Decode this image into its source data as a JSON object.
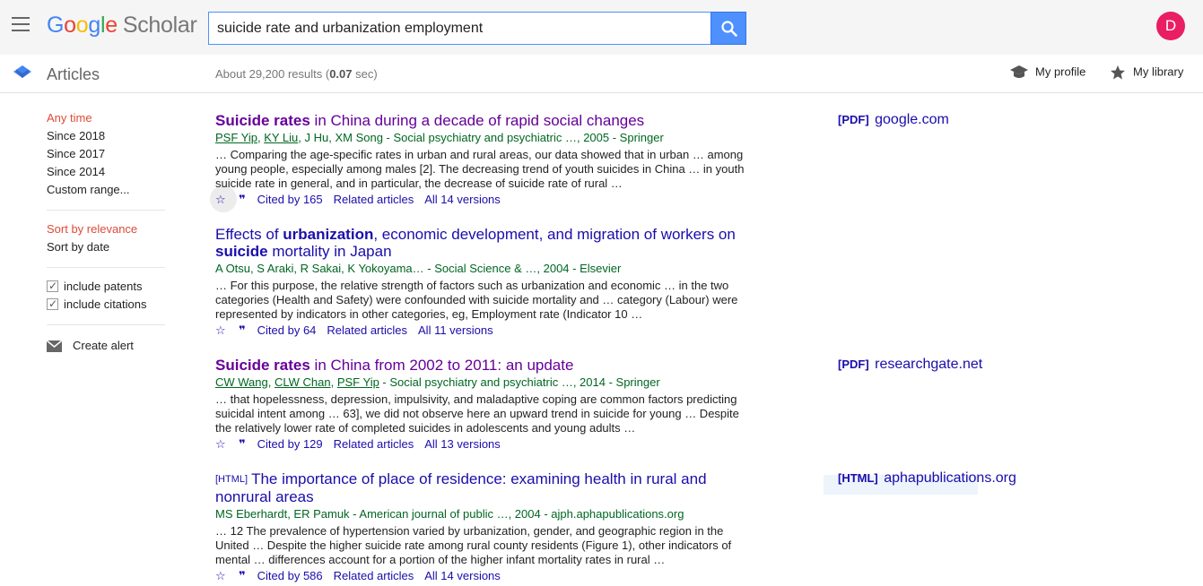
{
  "header": {
    "search_value": "suicide rate and urbanization employment",
    "avatar_letter": "D",
    "logo_google": [
      "G",
      "o",
      "o",
      "g",
      "l",
      "e"
    ],
    "logo_scholar": "Scholar"
  },
  "subbar": {
    "articles": "Articles",
    "results_prefix": "About 29,200 results (",
    "results_time": "0.07",
    "results_suffix": " sec)",
    "my_profile": "My profile",
    "my_library": "My library"
  },
  "sidebar": {
    "time_filters": [
      "Any time",
      "Since 2018",
      "Since 2017",
      "Since 2014",
      "Custom range..."
    ],
    "sort": [
      "Sort by relevance",
      "Sort by date"
    ],
    "include_patents": "include patents",
    "include_citations": "include citations",
    "create_alert": "Create alert"
  },
  "results": [
    {
      "title_bold": "Suicide rates",
      "title_rest": " in China during a decade of rapid social changes",
      "authors_linked": [
        "PSF Yip",
        "KY Liu"
      ],
      "authors_rest": "J Hu, XM Song - Social psychiatry and psychiatric …, 2005 - Springer",
      "snippet": "… Comparing the age-specific rates in urban and rural areas, our data showed that in urban … among young people, especially among males [2]. The decreasing trend of youth suicides in China … in youth suicide rate in general, and in particular, the decrease of suicide rate of rural …",
      "cited": "Cited by 165",
      "related": "Related articles",
      "versions": "All 14 versions",
      "side_tag": "[PDF]",
      "side_host": "google.com"
    },
    {
      "title_a": "Effects of ",
      "title_b": "urbanization",
      "title_c": ", economic development, and migration of workers on ",
      "title_d": "suicide",
      "title_e": " mortality in Japan",
      "authors": "A Otsu, S Araki, R Sakai, K Yokoyama… - Social Science & …, 2004 - Elsevier",
      "snippet": "… For this purpose, the relative strength of factors such as urbanization and economic … in the two categories (Health and Safety) were confounded with suicide mortality and … category (Labour) were represented by indicators in other categories, eg, Employment rate (Indicator 10 …",
      "cited": "Cited by 64",
      "related": "Related articles",
      "versions": "All 11 versions"
    },
    {
      "title_bold": "Suicide rates",
      "title_rest": " in China from 2002 to 2011: an update",
      "authors_linked": [
        "CW Wang",
        "CLW Chan",
        "PSF Yip"
      ],
      "authors_rest": " - Social psychiatry and psychiatric …, 2014 - Springer",
      "snippet": "… that hopelessness, depression, impulsivity, and maladaptive coping are common factors predicting suicidal intent among … 63], we did not observe here an upward trend in suicide for young … Despite the relatively lower rate of completed suicides in adolescents and young adults …",
      "cited": "Cited by 129",
      "related": "Related articles",
      "versions": "All 13 versions",
      "side_tag": "[PDF]",
      "side_host": "researchgate.net"
    },
    {
      "tag": "[HTML]",
      "title": "The importance of place of residence: examining health in rural and nonrural areas",
      "authors": "MS Eberhardt, ER Pamuk - American journal of public …, 2004 - ajph.aphapublications.org",
      "snippet": "… 12 The prevalence of hypertension varied by urbanization, gender, and geographic region in the United … Despite the higher suicide rate among rural county residents (Figure 1), other indicators of mental … differences account for a portion of the higher infant mortality rates in rural …",
      "cited": "Cited by 586",
      "related": "Related articles",
      "versions": "All 14 versions",
      "side_tag": "[HTML]",
      "side_host": "aphapublications.org"
    }
  ],
  "colors": {
    "link": "#1a0dab",
    "visited": "#660099",
    "authors": "#006621",
    "active_filter": "#dd4b39",
    "search_button": "#4d90fe",
    "avatar": "#e91e63"
  }
}
